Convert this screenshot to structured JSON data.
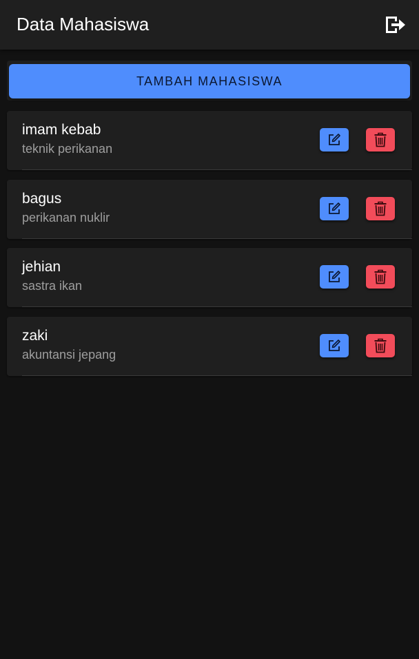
{
  "header": {
    "title": "Data Mahasiswa",
    "logout_icon": "logout-icon"
  },
  "actions": {
    "add_label": "TAMBAH MAHASISWA"
  },
  "colors": {
    "background": "#121212",
    "surface": "#1f1f1f",
    "primary": "#4f8dfd",
    "danger": "#f24c5a",
    "secondary_text": "#9e9e9e"
  },
  "students": [
    {
      "name": "imam kebab",
      "major": "teknik perikanan"
    },
    {
      "name": "bagus",
      "major": "perikanan nuklir"
    },
    {
      "name": "jehian",
      "major": "sastra ikan"
    },
    {
      "name": "zaki",
      "major": "akuntansi jepang"
    }
  ]
}
